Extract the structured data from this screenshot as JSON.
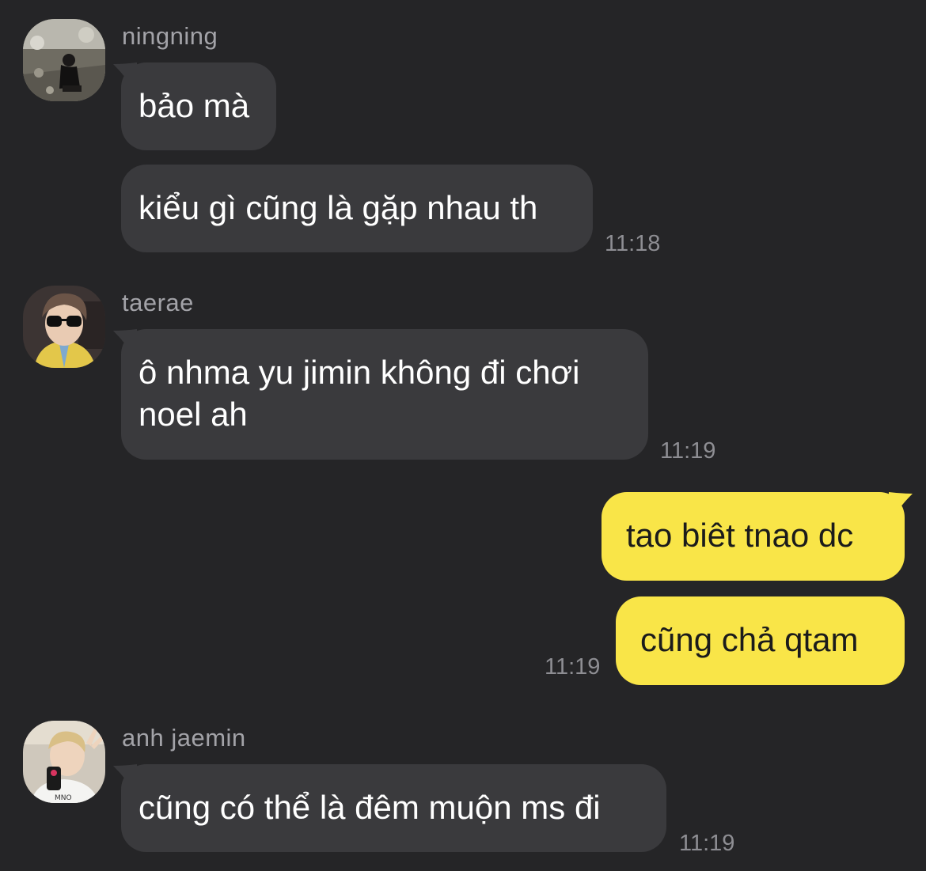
{
  "colors": {
    "background": "#252527",
    "incoming_bubble": "#3a3a3d",
    "outgoing_bubble": "#f9e548",
    "sender_name": "#a3a3a8",
    "timestamp": "#8e8e93"
  },
  "messages": [
    {
      "sender": "ningning",
      "avatar": "ningning-avatar",
      "bubbles": [
        "bảo mà",
        "kiểu gì cũng là gặp nhau th"
      ],
      "time": "11:18"
    },
    {
      "sender": "taerae",
      "avatar": "taerae-avatar",
      "bubbles": [
        "ô nhma yu jimin không đi chơi noel ah"
      ],
      "time": "11:19"
    },
    {
      "sender": "me",
      "outgoing": true,
      "bubbles": [
        "tao biêt tnao dc",
        "cũng chả qtam"
      ],
      "time": "11:19"
    },
    {
      "sender": "anh jaemin",
      "avatar": "jaemin-avatar",
      "bubbles": [
        "cũng có thể là đêm muộn ms đi"
      ],
      "time": "11:19"
    }
  ]
}
